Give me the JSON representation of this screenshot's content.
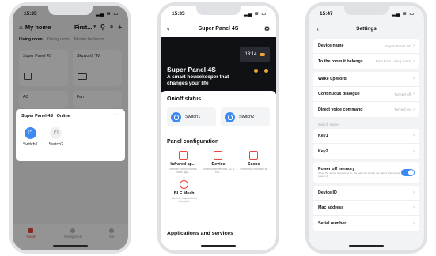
{
  "phone1": {
    "time": "15:35",
    "status_icons": "▂▄ ≋ ▭",
    "home_title": "My home",
    "dropdown": "First...",
    "rooms": [
      "Living room",
      "Dining room",
      "Master bedroom"
    ],
    "devices": [
      "Super Panel 4S",
      "Skyworth TV",
      "AC",
      "Fan"
    ],
    "popup": {
      "title": "Super Panel 4S | Online",
      "switches": [
        "Switch1",
        "Switch2"
      ]
    },
    "tabs": [
      "Room",
      "Intelligence",
      "Me"
    ]
  },
  "phone2": {
    "time": "15:35",
    "status_icons": "▂▄ ≋ ▭",
    "title": "Super Panel 4S",
    "hero": {
      "clock": "13:14",
      "headline": "Super Panel 4S",
      "tagline": "A smart housekeeper that changes your life"
    },
    "onoff_title": "On/off status",
    "switches": [
      "Switch1",
      "Switch2"
    ],
    "panel_config_title": "Panel configuration",
    "config_items": [
      {
        "name": "Infrared ap...",
        "desc": "Remote control infrared home app..."
      },
      {
        "name": "Device",
        "desc": "Whole house devices, AC & con..."
      },
      {
        "name": "Scene",
        "desc": "One button executes all"
      }
    ],
    "ble": {
      "name": "BLE Mesh",
      "desc": "Mesh to make without disruption"
    },
    "apps_title": "Applications and services"
  },
  "phone3": {
    "time": "15:47",
    "status_icons": "▂▄ ≋ ▭",
    "title": "Settings",
    "rows_group1": [
      {
        "label": "Device name",
        "value": "Super Panel 4S"
      },
      {
        "label": "To the room it belongs",
        "value": "First floor Living room"
      }
    ],
    "rows_group2": [
      {
        "label": "Wake up word",
        "value": ""
      },
      {
        "label": "Continuous dialogue",
        "value": "Turned off"
      },
      {
        "label": "Direct voice command",
        "value": "Turned on"
      }
    ],
    "switch_name_label": "Switch name",
    "rows_group3": [
      {
        "label": "Key1",
        "value": ""
      },
      {
        "label": "Key2",
        "value": ""
      }
    ],
    "power_off_memory": {
      "label": "Power off memory",
      "desc": "When the device is powered on, the relay will remain the state it was before power off"
    },
    "rows_group4": [
      {
        "label": "Device ID",
        "value": ""
      },
      {
        "label": "Mac address",
        "value": ""
      },
      {
        "label": "Serial number",
        "value": ""
      }
    ]
  },
  "colors": {
    "accent": "#3d8bf2",
    "brand_red": "#e8453c"
  }
}
